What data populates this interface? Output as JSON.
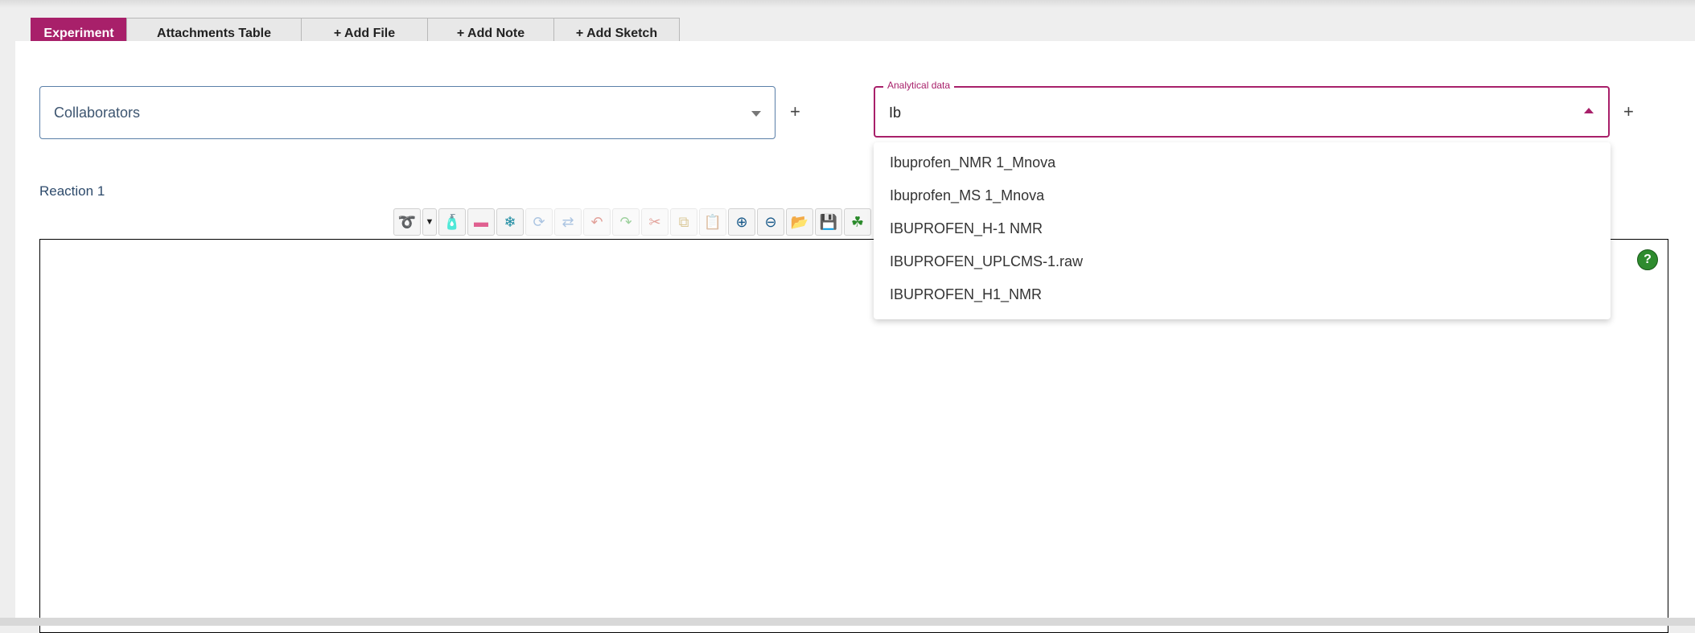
{
  "tabs": [
    {
      "label": "Experiment",
      "active": true
    },
    {
      "label": "Attachments Table",
      "active": false
    },
    {
      "label": "+ Add File",
      "active": false
    },
    {
      "label": "+ Add Note",
      "active": false
    },
    {
      "label": "+ Add Sketch",
      "active": false
    }
  ],
  "collaborators": {
    "placeholder": "Collaborators",
    "add_label": "+"
  },
  "analytical": {
    "legend": "Analytical data",
    "value": "Ib",
    "add_label": "+",
    "options": [
      "Ibuprofen_NMR 1_Mnova",
      "Ibuprofen_MS 1_Mnova",
      "IBUPROFEN_H-1 NMR",
      "IBUPROFEN_UPLCMS-1.raw",
      "IBUPROFEN_H1_NMR"
    ]
  },
  "reaction": {
    "label": "Reaction 1"
  },
  "toolbar": {
    "icons": [
      "lasso-icon",
      "dropdown-arrow-icon",
      "erase-bottle-icon",
      "eraser-icon",
      "center-icon",
      "rotate-icon",
      "flip-icon",
      "undo-icon",
      "redo-icon",
      "cut-icon",
      "copy-icon",
      "paste-icon",
      "zoom-in-icon",
      "zoom-out-icon",
      "open-folder-icon",
      "save-icon",
      "templates-icon"
    ]
  },
  "help": {
    "label": "?"
  },
  "colors": {
    "accent": "#a8206a",
    "help_green": "#2e8b2e"
  }
}
